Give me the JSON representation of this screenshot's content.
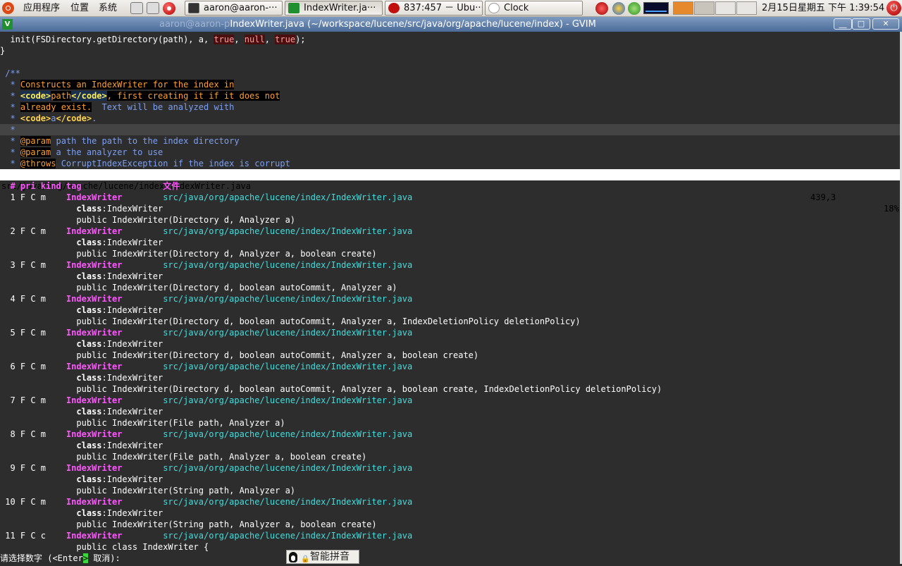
{
  "panel": {
    "menus": [
      "应用程序",
      "位置",
      "系统"
    ],
    "tasks": [
      {
        "label": "aaron@aaron-···",
        "icon": "terminal-icon"
      },
      {
        "label": "IndexWriter.ja···",
        "icon": "vim-icon"
      },
      {
        "label": "837:457 － Ubu···",
        "icon": "music-player-icon"
      },
      {
        "label": "Clock",
        "icon": "clock-icon"
      }
    ],
    "clock": "2月15日星期五 下午 1:39:54"
  },
  "window": {
    "title_ghost": "aaron@aaron-p",
    "title": "IndexWriter.java (~/workspace/lucene/src/java/org/apache/lucene/index) - GVIM",
    "buttons": {
      "minimize": "__",
      "maximize": "□",
      "close": "✕"
    }
  },
  "editor": {
    "code": {
      "l1_fn": "  init(FSDirectory.getDirectory(path), a, ",
      "l1_true1": "true",
      "l1_sep1": ", ",
      "l1_null": "null",
      "l1_sep2": ", ",
      "l1_true2": "true",
      "l1_end": ");",
      "l2": "}",
      "l4": " /**",
      "l5_star": "  * ",
      "l5_text": "Constructs an IndexWriter for the index in",
      "l6_star": "  * ",
      "l6_tag1": "<code>",
      "l6_path": "path",
      "l6_tag2": "</code>",
      "l6_rest": ", first creating it if it does not",
      "l7_star": "  * ",
      "l7_hi": "already exist.",
      "l7_rest": "  Text will be analyzed with",
      "l8_star": "  * ",
      "l8_tag1": "<code>",
      "l8_a": "a",
      "l8_tag2": "</code>",
      "l8_rest": ".",
      "l9": "  *",
      "l10_star": "  * ",
      "l10_param": "@param",
      "l10_name": " path",
      "l10_rest": " the path to the index directory",
      "l11_star": "  * ",
      "l11_param": "@param",
      "l11_name": " a",
      "l11_rest": " the analyzer to use",
      "l12_star": "  * ",
      "l12_throws": "@throws",
      "l12_name": " CorruptIndexException",
      "l12_rest": " if the index is corrupt"
    },
    "status": {
      "file": "src/java/org/apache/lucene/index/IndexWriter.java",
      "position": "439,3",
      "percent": "18%"
    },
    "taglist": {
      "header": "  # pri kind tag                文件",
      "tag": "IndexWriter",
      "path": "src/java/org/apache/lucene/index/IndexWriter.java",
      "class_kw": "class",
      "class_name": ":IndexWriter",
      "entries": [
        {
          "num": "  1 F C m    ",
          "sig": "public IndexWriter(Directory d, Analyzer a)"
        },
        {
          "num": "  2 F C m    ",
          "sig": "public IndexWriter(Directory d, Analyzer a, boolean create)"
        },
        {
          "num": "  3 F C m    ",
          "sig": "public IndexWriter(Directory d, boolean autoCommit, Analyzer a)"
        },
        {
          "num": "  4 F C m    ",
          "sig": "public IndexWriter(Directory d, boolean autoCommit, Analyzer a, IndexDeletionPolicy deletionPolicy)"
        },
        {
          "num": "  5 F C m    ",
          "sig": "public IndexWriter(Directory d, boolean autoCommit, Analyzer a, boolean create)"
        },
        {
          "num": "  6 F C m    ",
          "sig": "public IndexWriter(Directory d, boolean autoCommit, Analyzer a, boolean create, IndexDeletionPolicy deletionPolicy)"
        },
        {
          "num": "  7 F C m    ",
          "sig": "public IndexWriter(File path, Analyzer a)"
        },
        {
          "num": "  8 F C m    ",
          "sig": "public IndexWriter(File path, Analyzer a, boolean create)"
        },
        {
          "num": "  9 F C m    ",
          "sig": "public IndexWriter(String path, Analyzer a)"
        },
        {
          "num": " 10 F C m    ",
          "sig": "public IndexWriter(String path, Analyzer a, boolean create)"
        }
      ],
      "last": {
        "num": " 11 F C c    ",
        "sig": "public class IndexWriter {"
      }
    },
    "cmdline": {
      "prefix": "请选择数字 (<Enter",
      "cursor": ">",
      "suffix": " 取消):"
    }
  },
  "ime": {
    "label": "智能拼音"
  }
}
